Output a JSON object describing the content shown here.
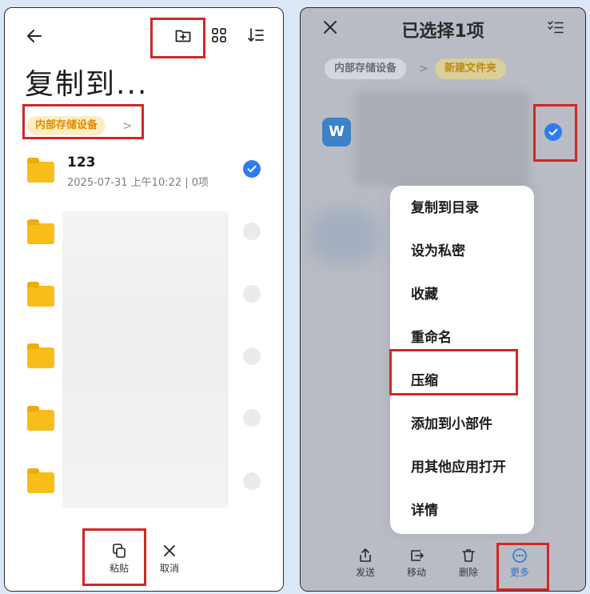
{
  "left": {
    "title": "复制到...",
    "breadcrumb": "内部存储设备",
    "breadcrumb_chevron": ">",
    "folders": [
      {
        "name": "123",
        "meta": "2025-07-31 上午10:22 | 0项",
        "checked": true
      },
      {
        "name": "",
        "meta": "",
        "checked": false
      },
      {
        "name": "",
        "meta": "",
        "checked": false
      },
      {
        "name": "",
        "meta": "",
        "checked": false
      },
      {
        "name": "",
        "meta": "",
        "checked": false
      },
      {
        "name": "",
        "meta": "",
        "checked": false
      }
    ],
    "toolbar": {
      "paste_label": "粘贴",
      "cancel_label": "取消"
    }
  },
  "right": {
    "title": "已选择1项",
    "breadcrumb": [
      "内部存储设备",
      "新建文件夹"
    ],
    "breadcrumb_chevron": ">",
    "file_icon_letter": "W",
    "menu": [
      "复制到目录",
      "设为私密",
      "收藏",
      "重命名",
      "压缩",
      "添加到小部件",
      "用其他应用打开",
      "详情"
    ],
    "toolbar": {
      "send_label": "发送",
      "move_label": "移动",
      "delete_label": "删除",
      "more_label": "更多"
    }
  },
  "colors": {
    "accent_blue": "#2f7bf0",
    "folder_yellow": "#f8bd18",
    "highlight_red": "#d32626",
    "breadcrumb_bg": "#fbeec4",
    "breadcrumb_text": "#e28b00"
  }
}
